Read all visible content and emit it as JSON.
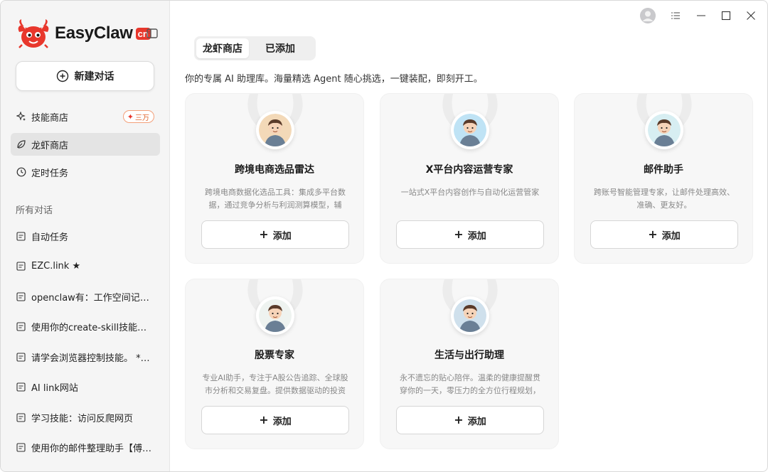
{
  "app": {
    "name": "EasyClaw",
    "badge": "cn"
  },
  "sidebar": {
    "new_chat_label": "新建对话",
    "nav": [
      {
        "label": "技能商店",
        "icon": "sparkle-icon",
        "badge": "三万"
      },
      {
        "label": "龙虾商店",
        "icon": "leaf-icon",
        "active": true
      },
      {
        "label": "定时任务",
        "icon": "clock-icon"
      }
    ],
    "section_label": "所有对话",
    "conversations": [
      "自动任务",
      "EZC.link ★",
      "openclaw有：工作空间记忆…",
      "使用你的create-skill技能，来…",
      "请学会浏览器控制技能。 **…",
      "AI link网站",
      "学习技能：访问反爬网页",
      "使用你的邮件整理助手【傅…"
    ]
  },
  "main": {
    "tabs": [
      {
        "label": "龙虾商店",
        "active": true
      },
      {
        "label": "已添加",
        "active": false
      }
    ],
    "intro": "你的专属 AI 助理库。海量精选 Agent 随心挑选，一键装配，即刻开工。",
    "add_label": "添加",
    "cards": [
      {
        "title": "跨境电商选品雷达",
        "desc": "跨境电商数据化选品工具：集成多平台数据，通过竞争分析与利润测算模型，辅助…",
        "avatar": "person-icon",
        "color": "#f3d9b8"
      },
      {
        "title": "X平台内容运营专家",
        "desc": "一站式X平台内容创作与自动化运营管家",
        "avatar": "person-icon",
        "color": "#bfe3f5"
      },
      {
        "title": "邮件助手",
        "desc": "跨账号智能管理专家，让邮件处理高效、准确、更友好。",
        "avatar": "person-icon",
        "color": "#d7eef2"
      },
      {
        "title": "股票专家",
        "desc": "专业AI助手，专注于A股公告追踪、全球股市分析和交易复盘。提供数据驱动的投资决…",
        "avatar": "person-icon",
        "color": "#eef3f0"
      },
      {
        "title": "生活与出行助理",
        "desc": "永不遗忘的贴心陪伴。温柔的健康提醒贯穿你的一天，零压力的全方位行程规划，智…",
        "avatar": "person-icon",
        "color": "#cfe0ec"
      }
    ]
  },
  "colors": {
    "brand": "#e8372c",
    "sidebar_bg": "#f5f5f5",
    "card_bg": "#f7f7f7"
  }
}
